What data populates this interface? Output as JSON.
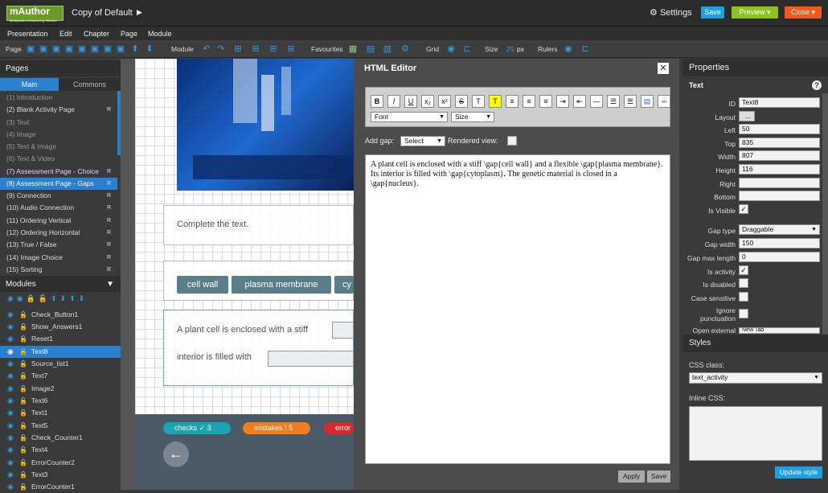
{
  "app": {
    "logo": "mAuthor",
    "logo_sub": "Multiplatform eAuthoring Solution",
    "doc_title": "Copy of Default",
    "settings": "Settings",
    "save": "Save",
    "preview": "Preview",
    "close": "Close"
  },
  "menu": [
    "Presentation",
    "Edit",
    "Chapter",
    "Page",
    "Module"
  ],
  "toolbar": {
    "page": "Page",
    "module": "Module",
    "favourites": "Favourites",
    "grid": "Grid",
    "size": "Size",
    "size_value": "25",
    "size_unit": "px",
    "rulers": "Rulers"
  },
  "pages": {
    "title": "Pages",
    "tabs": [
      "Main",
      "Commons"
    ],
    "items": [
      {
        "label": "(1) Introduction",
        "r": ""
      },
      {
        "label": "(2) Blank Activity Page",
        "r": "R"
      },
      {
        "label": "(3) Text",
        "r": ""
      },
      {
        "label": "(4) Image",
        "r": ""
      },
      {
        "label": "(5) Text & Image",
        "r": ""
      },
      {
        "label": "(6) Text & Video",
        "r": ""
      },
      {
        "label": "(7) Assessment Page - Choice",
        "r": "R"
      },
      {
        "label": "(8) Assessment Page - Gaps",
        "r": "R"
      },
      {
        "label": "(9) Connection",
        "r": "R"
      },
      {
        "label": "(10) Audio Connection",
        "r": "R"
      },
      {
        "label": "(11) Ordering Vertical",
        "r": "R"
      },
      {
        "label": "(12) Ordering Horizontal",
        "r": "R"
      },
      {
        "label": "(13) True / False",
        "r": "R"
      },
      {
        "label": "(14) Image Choice",
        "r": "R"
      },
      {
        "label": "(15) Sorting",
        "r": "R"
      }
    ]
  },
  "modules": {
    "title": "Modules",
    "items": [
      "Check_Button1",
      "Show_Answers1",
      "Reset1",
      "Text8",
      "Source_list1",
      "Text7",
      "Image2",
      "Text6",
      "Text1",
      "Text5",
      "Check_Counter1",
      "Text4",
      "ErrorCounter2",
      "Text3",
      "ErrorCounter1"
    ]
  },
  "canvas": {
    "instruction": "Complete the text.",
    "chips": [
      "cell wall",
      "plasma membrane",
      "cy"
    ],
    "line1": "A plant cell is enclosed with a stiff",
    "line2": "interior is filled with",
    "checks_label": "checks",
    "checks_value": "3",
    "mistakes_label": "mistakes",
    "mistakes_value": "5",
    "errors_label": "error"
  },
  "editor": {
    "title": "HTML Editor",
    "font": "Font",
    "size": "Size",
    "add_gap": "Add gap:",
    "add_gap_value": "Select",
    "rendered_view": "Rendered view:",
    "content": "A plant cell is enclosed with a stiff \\gap{cell wall} and a flexible \\gap{plasma membrane}. Its interior is filled with \\gap{cytoplasm}. The genetic material is closed in a \\gap{nucleus}.",
    "apply": "Apply",
    "save": "Save"
  },
  "properties": {
    "title": "Properties",
    "type": "Text",
    "fields": [
      {
        "label": "ID",
        "value": "Text8"
      },
      {
        "label": "Layout",
        "value": "..."
      },
      {
        "label": "Left",
        "value": "50"
      },
      {
        "label": "Top",
        "value": "835"
      },
      {
        "label": "Width",
        "value": "807"
      },
      {
        "label": "Height",
        "value": "116"
      },
      {
        "label": "Right",
        "value": ""
      },
      {
        "label": "Bottom",
        "value": ""
      }
    ],
    "is_visible": "Is Visible",
    "gap_type": "Gap type",
    "gap_type_value": "Draggable",
    "gap_width": "Gap width",
    "gap_width_value": "150",
    "gap_max_length": "Gap max length",
    "gap_max_length_value": "0",
    "is_activity": "Is activity",
    "is_disabled": "Is disabled",
    "case_sensitive": "Case sensitive",
    "ignore_punctuation": "Ignore punctuation",
    "open_external": "Open external",
    "open_external_value": "New Tab"
  },
  "styles": {
    "title": "Styles",
    "css_class": "CSS class:",
    "css_class_value": "text_activity",
    "inline_css": "Inline CSS:",
    "update": "Update style"
  }
}
